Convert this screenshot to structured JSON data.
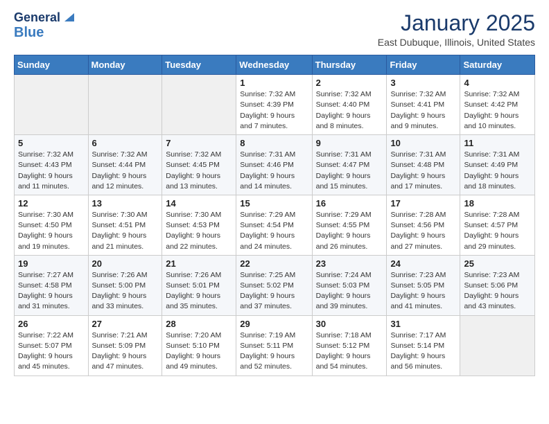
{
  "logo": {
    "line1": "General",
    "line2": "Blue"
  },
  "header": {
    "month": "January 2025",
    "location": "East Dubuque, Illinois, United States"
  },
  "weekdays": [
    "Sunday",
    "Monday",
    "Tuesday",
    "Wednesday",
    "Thursday",
    "Friday",
    "Saturday"
  ],
  "weeks": [
    [
      {
        "day": "",
        "info": ""
      },
      {
        "day": "",
        "info": ""
      },
      {
        "day": "",
        "info": ""
      },
      {
        "day": "1",
        "info": "Sunrise: 7:32 AM\nSunset: 4:39 PM\nDaylight: 9 hours and 7 minutes."
      },
      {
        "day": "2",
        "info": "Sunrise: 7:32 AM\nSunset: 4:40 PM\nDaylight: 9 hours and 8 minutes."
      },
      {
        "day": "3",
        "info": "Sunrise: 7:32 AM\nSunset: 4:41 PM\nDaylight: 9 hours and 9 minutes."
      },
      {
        "day": "4",
        "info": "Sunrise: 7:32 AM\nSunset: 4:42 PM\nDaylight: 9 hours and 10 minutes."
      }
    ],
    [
      {
        "day": "5",
        "info": "Sunrise: 7:32 AM\nSunset: 4:43 PM\nDaylight: 9 hours and 11 minutes."
      },
      {
        "day": "6",
        "info": "Sunrise: 7:32 AM\nSunset: 4:44 PM\nDaylight: 9 hours and 12 minutes."
      },
      {
        "day": "7",
        "info": "Sunrise: 7:32 AM\nSunset: 4:45 PM\nDaylight: 9 hours and 13 minutes."
      },
      {
        "day": "8",
        "info": "Sunrise: 7:31 AM\nSunset: 4:46 PM\nDaylight: 9 hours and 14 minutes."
      },
      {
        "day": "9",
        "info": "Sunrise: 7:31 AM\nSunset: 4:47 PM\nDaylight: 9 hours and 15 minutes."
      },
      {
        "day": "10",
        "info": "Sunrise: 7:31 AM\nSunset: 4:48 PM\nDaylight: 9 hours and 17 minutes."
      },
      {
        "day": "11",
        "info": "Sunrise: 7:31 AM\nSunset: 4:49 PM\nDaylight: 9 hours and 18 minutes."
      }
    ],
    [
      {
        "day": "12",
        "info": "Sunrise: 7:30 AM\nSunset: 4:50 PM\nDaylight: 9 hours and 19 minutes."
      },
      {
        "day": "13",
        "info": "Sunrise: 7:30 AM\nSunset: 4:51 PM\nDaylight: 9 hours and 21 minutes."
      },
      {
        "day": "14",
        "info": "Sunrise: 7:30 AM\nSunset: 4:53 PM\nDaylight: 9 hours and 22 minutes."
      },
      {
        "day": "15",
        "info": "Sunrise: 7:29 AM\nSunset: 4:54 PM\nDaylight: 9 hours and 24 minutes."
      },
      {
        "day": "16",
        "info": "Sunrise: 7:29 AM\nSunset: 4:55 PM\nDaylight: 9 hours and 26 minutes."
      },
      {
        "day": "17",
        "info": "Sunrise: 7:28 AM\nSunset: 4:56 PM\nDaylight: 9 hours and 27 minutes."
      },
      {
        "day": "18",
        "info": "Sunrise: 7:28 AM\nSunset: 4:57 PM\nDaylight: 9 hours and 29 minutes."
      }
    ],
    [
      {
        "day": "19",
        "info": "Sunrise: 7:27 AM\nSunset: 4:58 PM\nDaylight: 9 hours and 31 minutes."
      },
      {
        "day": "20",
        "info": "Sunrise: 7:26 AM\nSunset: 5:00 PM\nDaylight: 9 hours and 33 minutes."
      },
      {
        "day": "21",
        "info": "Sunrise: 7:26 AM\nSunset: 5:01 PM\nDaylight: 9 hours and 35 minutes."
      },
      {
        "day": "22",
        "info": "Sunrise: 7:25 AM\nSunset: 5:02 PM\nDaylight: 9 hours and 37 minutes."
      },
      {
        "day": "23",
        "info": "Sunrise: 7:24 AM\nSunset: 5:03 PM\nDaylight: 9 hours and 39 minutes."
      },
      {
        "day": "24",
        "info": "Sunrise: 7:23 AM\nSunset: 5:05 PM\nDaylight: 9 hours and 41 minutes."
      },
      {
        "day": "25",
        "info": "Sunrise: 7:23 AM\nSunset: 5:06 PM\nDaylight: 9 hours and 43 minutes."
      }
    ],
    [
      {
        "day": "26",
        "info": "Sunrise: 7:22 AM\nSunset: 5:07 PM\nDaylight: 9 hours and 45 minutes."
      },
      {
        "day": "27",
        "info": "Sunrise: 7:21 AM\nSunset: 5:09 PM\nDaylight: 9 hours and 47 minutes."
      },
      {
        "day": "28",
        "info": "Sunrise: 7:20 AM\nSunset: 5:10 PM\nDaylight: 9 hours and 49 minutes."
      },
      {
        "day": "29",
        "info": "Sunrise: 7:19 AM\nSunset: 5:11 PM\nDaylight: 9 hours and 52 minutes."
      },
      {
        "day": "30",
        "info": "Sunrise: 7:18 AM\nSunset: 5:12 PM\nDaylight: 9 hours and 54 minutes."
      },
      {
        "day": "31",
        "info": "Sunrise: 7:17 AM\nSunset: 5:14 PM\nDaylight: 9 hours and 56 minutes."
      },
      {
        "day": "",
        "info": ""
      }
    ]
  ]
}
